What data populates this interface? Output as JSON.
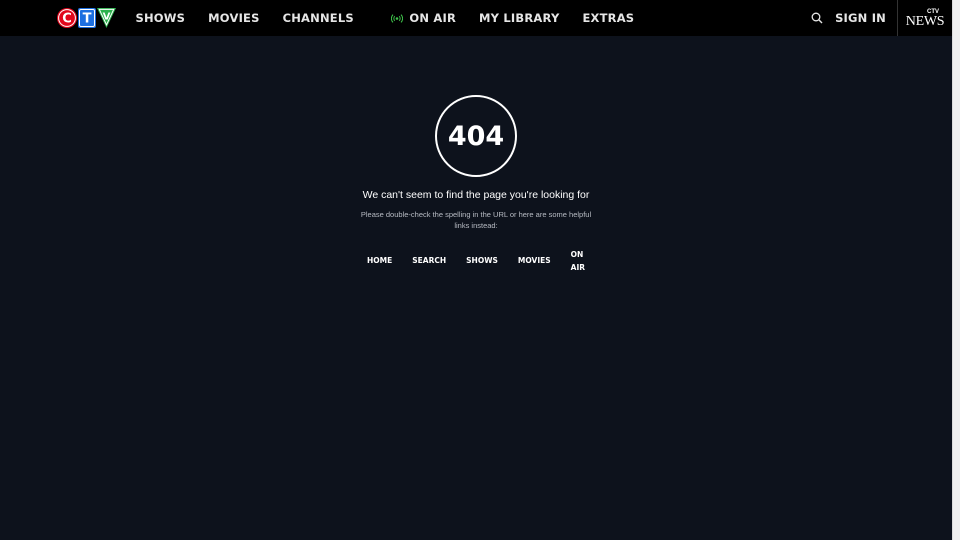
{
  "header": {
    "logo_alt": "CTV",
    "nav": [
      {
        "label": "SHOWS"
      },
      {
        "label": "MOVIES"
      },
      {
        "label": "CHANNELS"
      },
      {
        "label": "ON AIR"
      },
      {
        "label": "MY LIBRARY"
      },
      {
        "label": "EXTRAS"
      }
    ],
    "sign_in": "SIGN IN",
    "news_logo": {
      "top": "CTV",
      "word": "NEWS"
    }
  },
  "error": {
    "code": "404",
    "headline": "We can't seem to find the page you're looking for",
    "message": "Please double-check the spelling in the URL or here are some helpful links instead:",
    "links": [
      {
        "label": "HOME"
      },
      {
        "label": "SEARCH"
      },
      {
        "label": "SHOWS"
      },
      {
        "label": "MOVIES"
      },
      {
        "label": "ON AIR"
      }
    ]
  },
  "colors": {
    "background": "#0d121c",
    "header": "#000000",
    "logo_c": "#e1061b",
    "logo_t": "#1d6fe0",
    "logo_v": "#2bb24c",
    "on_air_icon": "#3ec24a"
  },
  "icons": {
    "search": "search-icon",
    "on_air": "broadcast-icon"
  }
}
